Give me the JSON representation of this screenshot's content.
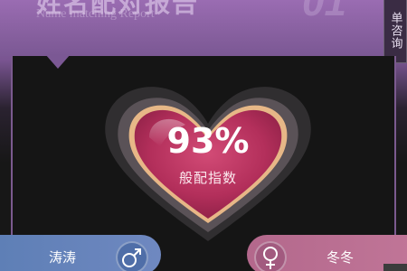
{
  "header": {
    "title": "姓名配对报告",
    "subtitle": "Name matching Report",
    "section_number": "01"
  },
  "side_tab": {
    "label": "单咨询"
  },
  "match": {
    "score": "93%",
    "caption": "般配指数"
  },
  "people": {
    "male_name": "涛涛",
    "female_name": "冬冬"
  },
  "icons": {
    "male": "male-symbol-icon",
    "female": "female-symbol-icon",
    "heart": "heart-icon"
  },
  "colors": {
    "header": "#845e9c",
    "panel": "#151515",
    "heart": "#c03a66",
    "male_pill": "#6f88c0",
    "female_pill": "#c07597"
  }
}
